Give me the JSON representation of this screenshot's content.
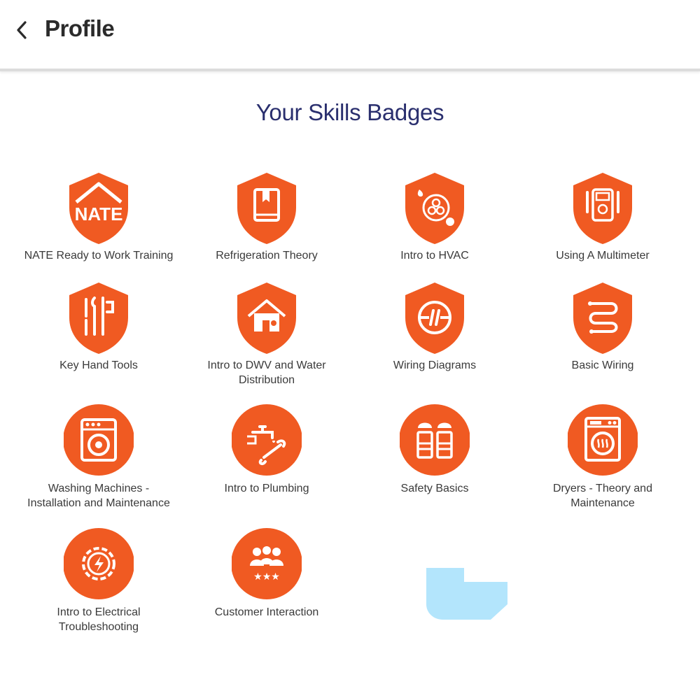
{
  "header": {
    "title": "Profile"
  },
  "section_title": "Your Skills Badges",
  "badges": [
    {
      "label": "NATE Ready to Work Training"
    },
    {
      "label": "Refrigeration Theory"
    },
    {
      "label": "Intro to HVAC"
    },
    {
      "label": "Using A Multimeter"
    },
    {
      "label": "Key Hand Tools"
    },
    {
      "label": "Intro to DWV and Water Distribution"
    },
    {
      "label": "Wiring Diagrams"
    },
    {
      "label": "Basic Wiring"
    },
    {
      "label": "Washing Machines - Installation and Maintenance"
    },
    {
      "label": "Intro to Plumbing"
    },
    {
      "label": "Safety Basics"
    },
    {
      "label": "Dryers - Theory and Maintenance"
    },
    {
      "label": "Intro to Electrical Troubleshooting"
    },
    {
      "label": "Customer Interaction"
    }
  ],
  "nate_logo_text": "NATE",
  "colors": {
    "badge": "#F05A22",
    "title": "#2a2f6e",
    "overlay": "#b3e5fc"
  }
}
